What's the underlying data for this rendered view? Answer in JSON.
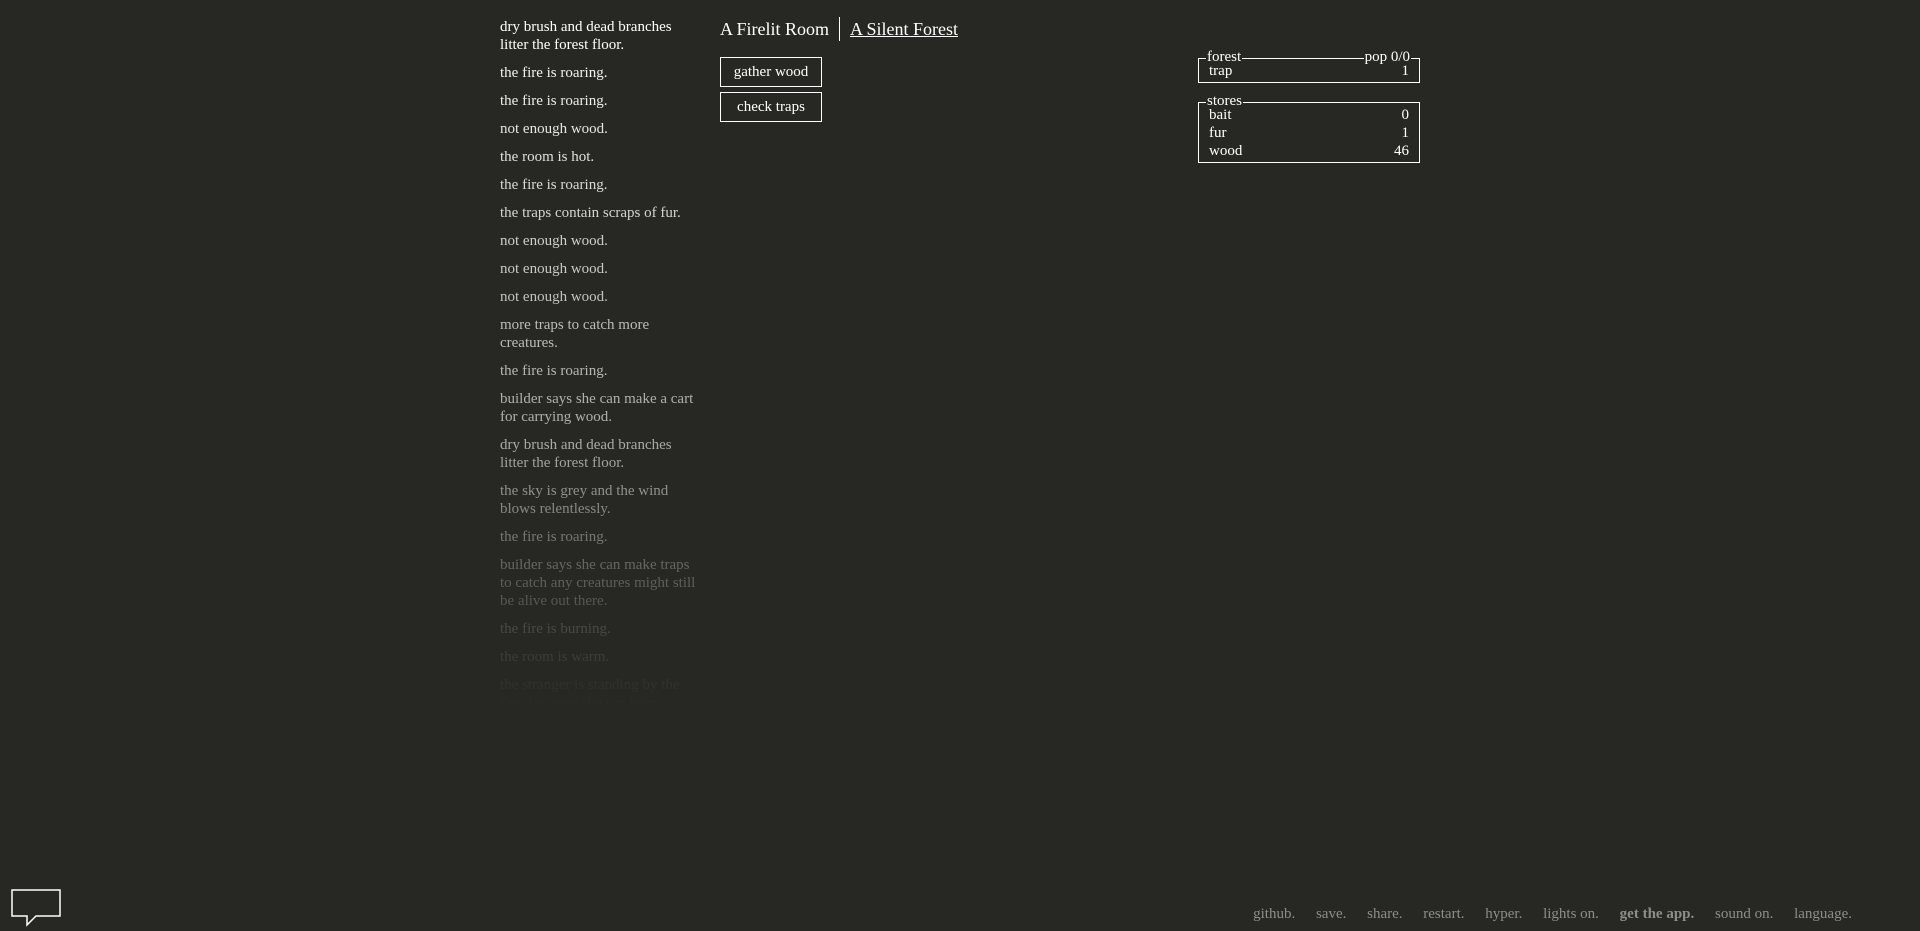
{
  "notifications": [
    {
      "text": "dry brush and dead branches litter the forest floor.",
      "color": "#ffffff"
    },
    {
      "text": "the fire is roaring.",
      "color": "#f2f2f1"
    },
    {
      "text": "the fire is roaring.",
      "color": "#ececeb"
    },
    {
      "text": "not enough wood.",
      "color": "#e6e6e5"
    },
    {
      "text": "the room is hot.",
      "color": "#e0e0df"
    },
    {
      "text": "the fire is roaring.",
      "color": "#dadad8"
    },
    {
      "text": "the traps contain scraps of fur.",
      "color": "#d4d4d2"
    },
    {
      "text": "not enough wood.",
      "color": "#cececc"
    },
    {
      "text": "not enough wood.",
      "color": "#c8c8c6"
    },
    {
      "text": "not enough wood.",
      "color": "#c2c2c0"
    },
    {
      "text": "more traps to catch more creatures.",
      "color": "#bcbcb9"
    },
    {
      "text": "the fire is roaring.",
      "color": "#b6b6b3"
    },
    {
      "text": "builder says she can make a cart for carrying wood.",
      "color": "#b0b0ad"
    },
    {
      "text": "dry brush and dead branches litter the forest floor.",
      "color": "#aaaaa7"
    },
    {
      "text": "the sky is grey and the wind blows relentlessly.",
      "color": "#a4a4a1"
    },
    {
      "text": "the fire is roaring.",
      "color": "#9e9e9b"
    },
    {
      "text": "builder says she can make traps to catch any creatures might still be alive out there.",
      "color": "#989895"
    },
    {
      "text": "the fire is burning.",
      "color": "#92928f"
    },
    {
      "text": "the room is warm.",
      "color": "#8c8c89"
    },
    {
      "text": "the stranger is standing by the fire. she says she can help.",
      "color": "#868683"
    }
  ],
  "header": {
    "tabs": [
      {
        "label": "A Firelit Room",
        "selected": true
      },
      {
        "label": "A Silent Forest",
        "selected": false
      }
    ]
  },
  "actions": {
    "gather_wood": "gather wood",
    "check_traps": "check traps"
  },
  "forest": {
    "legend": "forest",
    "population": "pop 0/0",
    "rows": [
      {
        "name": "trap",
        "value": "1"
      }
    ]
  },
  "stores": {
    "legend": "stores",
    "rows": [
      {
        "name": "bait",
        "value": "0"
      },
      {
        "name": "fur",
        "value": "1"
      },
      {
        "name": "wood",
        "value": "46"
      }
    ]
  },
  "footer": {
    "github": "github.",
    "save": "save.",
    "share": "share.",
    "restart": "restart.",
    "hyper": "hyper.",
    "lights": "lights on.",
    "get_app": "get the app.",
    "sound": "sound on.",
    "language": "language."
  },
  "colors": {
    "background": "#272823",
    "foreground": "#ffffff",
    "footer_text": "#8d8d89"
  },
  "icons": {
    "chat": "speech-bubble-icon"
  }
}
